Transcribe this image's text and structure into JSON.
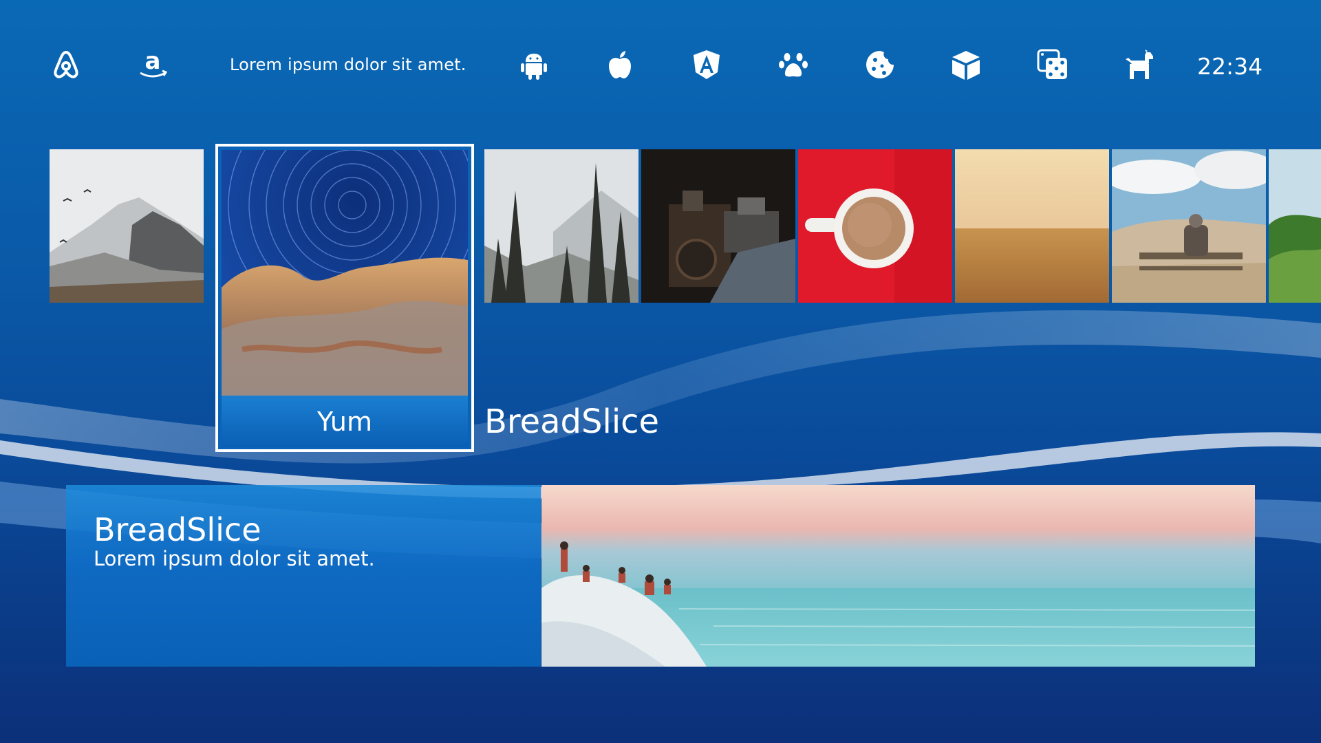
{
  "topbar": {
    "message": "Lorem ipsum dolor sit amet.",
    "clock": "22:34",
    "icons": [
      "airbnb-icon",
      "amazon-icon",
      "android-icon",
      "apple-icon",
      "angular-icon",
      "paw-icon",
      "cookie-icon",
      "box-icon",
      "dice-icon",
      "dog-icon"
    ]
  },
  "selected": {
    "caption": "Yum",
    "title": "BreadSlice"
  },
  "tiles": [
    "mountain-birds",
    "pine-forest",
    "old-machine",
    "coffee-cup",
    "desert",
    "bench-dunes",
    "green-hills"
  ],
  "panel": {
    "title": "BreadSlice",
    "subtitle": "Lorem ipsum dolor sit amet."
  },
  "colors": {
    "background_top": "#0a69b5",
    "background_bottom": "#0c307a",
    "caption_bar": "#0a5fb4"
  }
}
